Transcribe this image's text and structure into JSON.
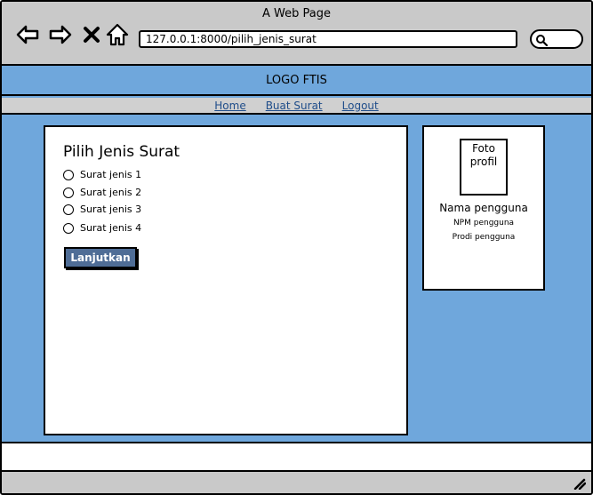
{
  "window": {
    "title": "A Web Page"
  },
  "browser": {
    "url": "127.0.0.1:8000/pilih_jenis_surat",
    "icons": [
      "back-arrow-icon",
      "forward-arrow-icon",
      "close-x-icon",
      "home-icon",
      "search-icon"
    ]
  },
  "header": {
    "logo": "LOGO FTIS"
  },
  "nav": {
    "items": [
      {
        "label": "Home"
      },
      {
        "label": "Buat Surat"
      },
      {
        "label": "Logout"
      }
    ]
  },
  "form": {
    "title": "Pilih Jenis Surat",
    "options": [
      {
        "label": "Surat jenis 1"
      },
      {
        "label": "Surat jenis 2"
      },
      {
        "label": "Surat jenis 3"
      },
      {
        "label": "Surat jenis 4"
      }
    ],
    "submit_label": "Lanjutkan"
  },
  "profile": {
    "photo_label_1": "Foto",
    "photo_label_2": "profil",
    "name": "Nama pengguna",
    "npm": "NPM pengguna",
    "prodi": "Prodi pengguna"
  },
  "colors": {
    "page_background": "#6fa7dc",
    "chrome": "#c9c9c9",
    "button": "#4f6d96",
    "link": "#1f4d8a"
  }
}
